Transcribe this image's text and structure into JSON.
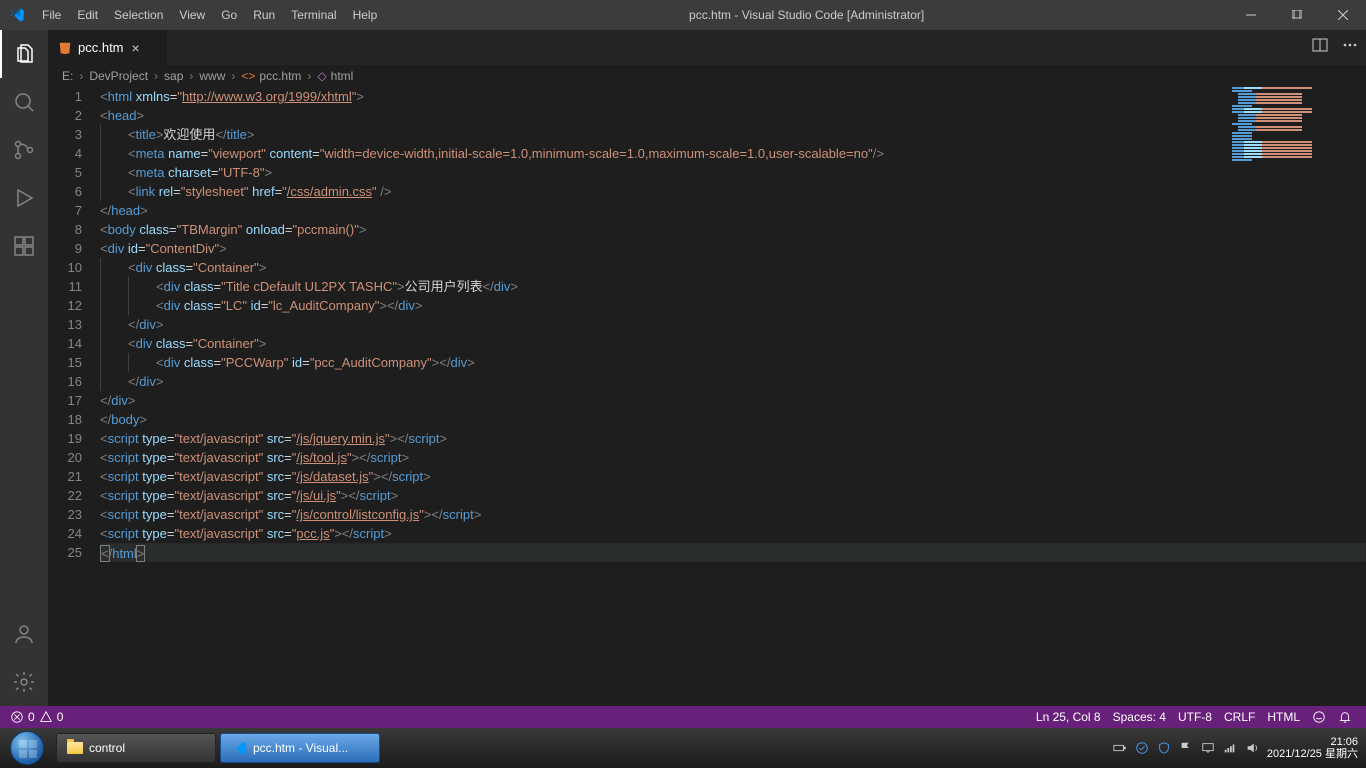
{
  "titlebar": {
    "menu": [
      "File",
      "Edit",
      "Selection",
      "View",
      "Go",
      "Run",
      "Terminal",
      "Help"
    ],
    "title": "pcc.htm - Visual Studio Code [Administrator]"
  },
  "tab": {
    "label": "pcc.htm"
  },
  "breadcrumbs": {
    "p0": "E:",
    "p1": "DevProject",
    "p2": "sap",
    "p3": "www",
    "p4": "pcc.htm",
    "p5": "html"
  },
  "code": {
    "title_text": "欢迎使用",
    "xmlns": "http://www.w3.org/1999/xhtml",
    "viewport": "width=device-width,initial-scale=1.0,minimum-scale=1.0,maximum-scale=1.0,user-scalable=no",
    "charset": "UTF-8",
    "stylesheet": "/css/admin.css",
    "body_class": "TBMargin",
    "body_onload": "pccmain()",
    "contentdiv_id": "ContentDiv",
    "container_class": "Container",
    "title_div_class": "Title cDefault UL2PX TASHC",
    "title_div_text": "公司用户列表",
    "lc_class": "LC",
    "lc_id": "lc_AuditCompany",
    "pccwarp_class": "PCCWarp",
    "pccwarp_id": "pcc_AuditCompany",
    "script_type": "text/javascript",
    "scripts": [
      "/js/jquery.min.js",
      "/js/tool.js",
      "/js/dataset.js",
      "/js/ui.js",
      "/js/control/listconfig.js",
      "pcc.js"
    ]
  },
  "status": {
    "errors": "0",
    "warnings": "0",
    "ln_col": "Ln 25, Col 8",
    "spaces": "Spaces: 4",
    "encoding": "UTF-8",
    "eol": "CRLF",
    "lang": "HTML"
  },
  "taskbar": {
    "btn1": "control",
    "btn2": "pcc.htm - Visual...",
    "clock_time": "21:06",
    "clock_date": "2021/12/25 星期六"
  }
}
